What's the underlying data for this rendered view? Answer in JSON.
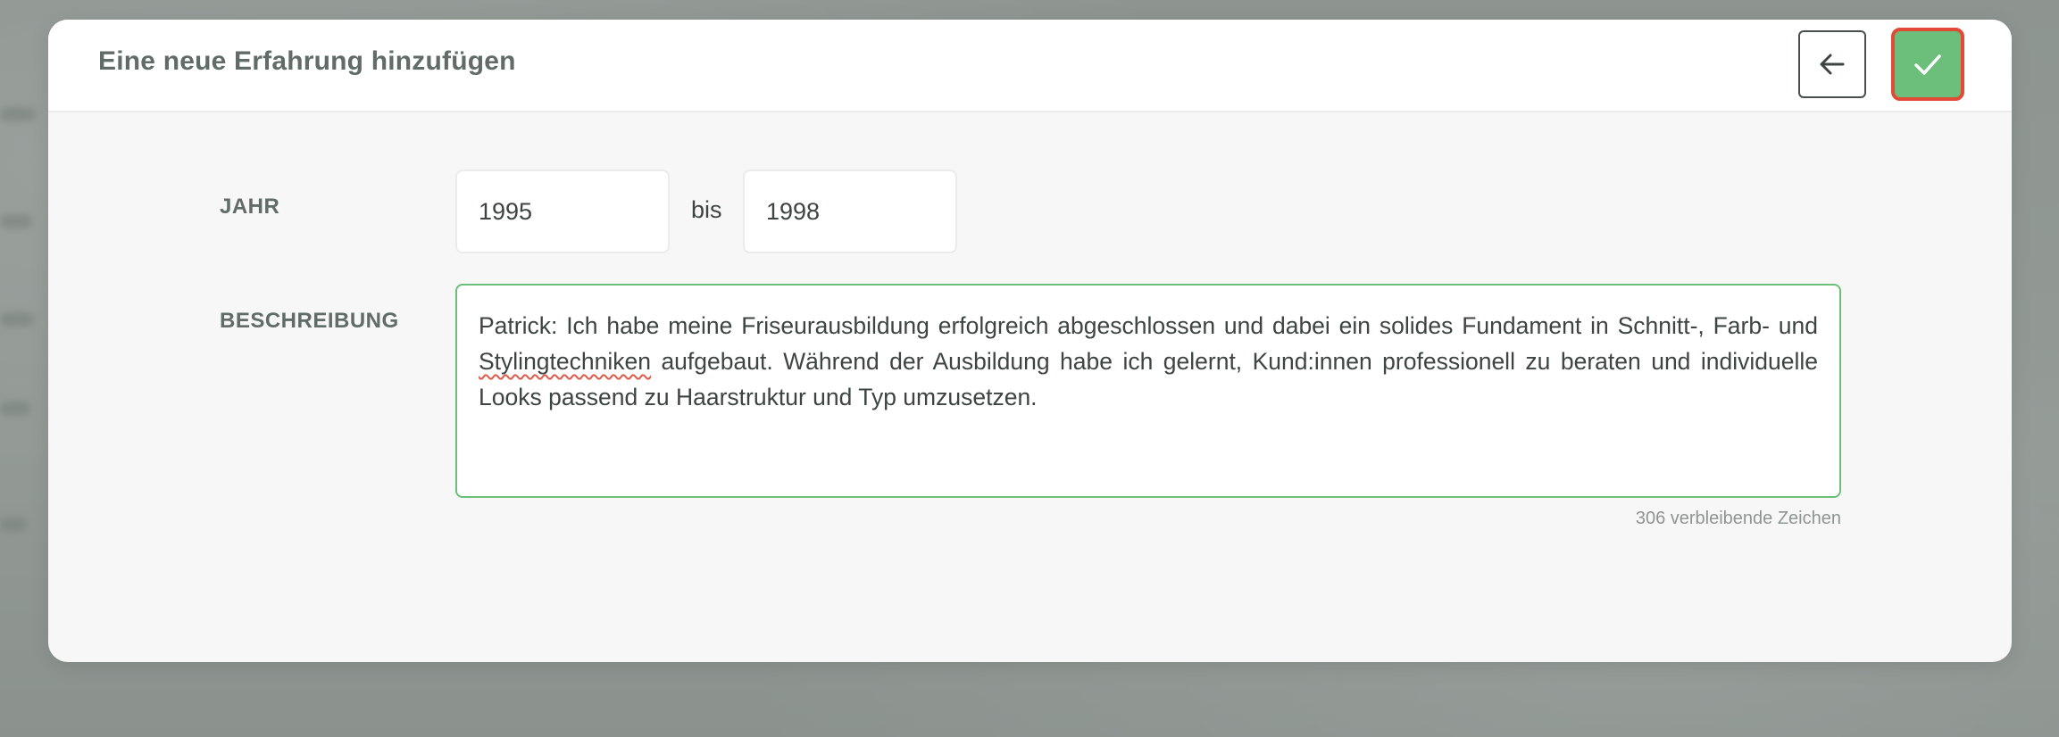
{
  "modal": {
    "title": "Eine neue Erfahrung hinzufügen",
    "back_icon": "arrow-left-icon",
    "confirm_icon": "checkmark-icon",
    "confirm_color": "#6cbf7a",
    "confirm_focus_outline": "#e24a35"
  },
  "form": {
    "year_label": "JAHR",
    "year_from": "1995",
    "year_separator": "bis",
    "year_to": "1998",
    "description_label": "BESCHREIBUNG",
    "description_before": "Patrick: Ich habe meine Friseurausbildung erfolgreich abgeschlossen und dabei ein solides Fundament in Schnitt-, Farb- und ",
    "description_misspelled": "Stylingtechniken",
    "description_after": " aufgebaut. Während der Ausbildung habe ich gelernt, Kund:innen professionell zu beraten und individuelle Looks passend zu Haarstruktur und Typ umzusetzen.",
    "remaining_chars": "306 verbleibende Zeichen"
  }
}
